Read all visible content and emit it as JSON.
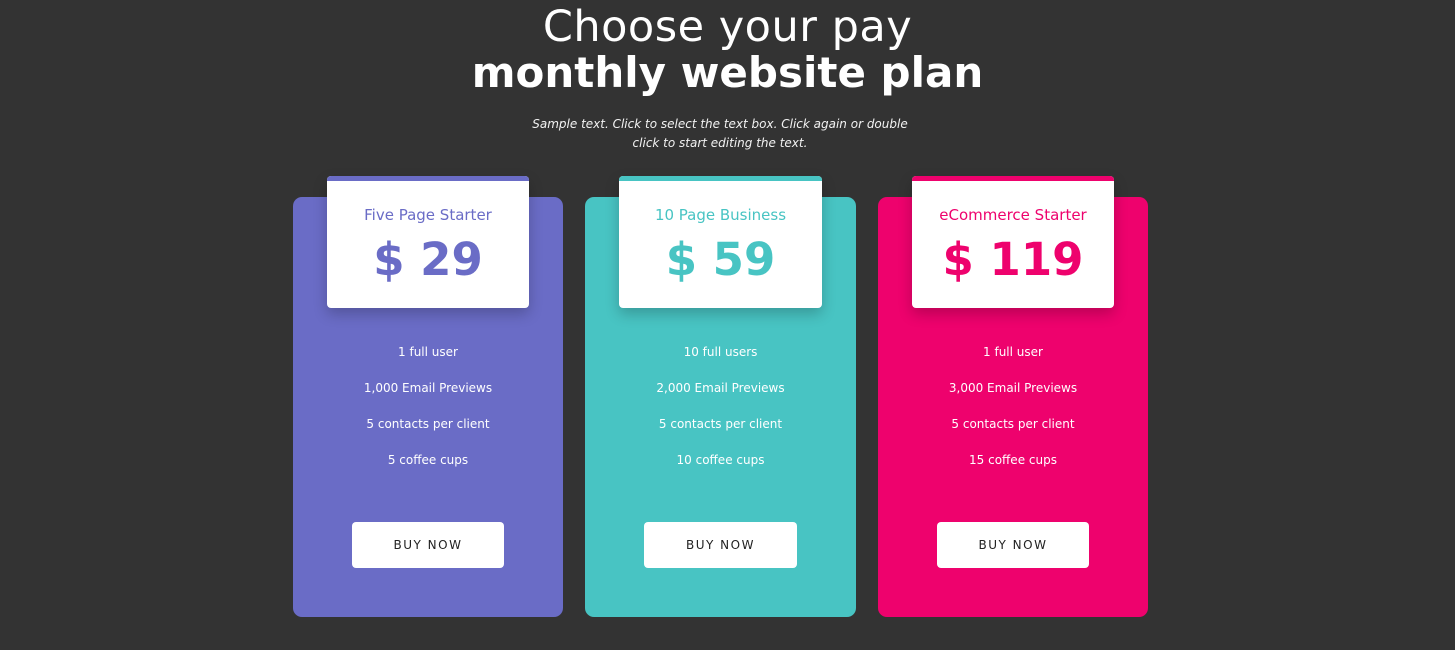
{
  "header": {
    "title_line1": "Choose your pay",
    "title_line2": "monthly website plan",
    "subtext": "Sample text. Click to select the text box. Click again or double click to start editing the text."
  },
  "colors": {
    "background": "#333333",
    "plan1": "#6a6cc6",
    "plan2": "#48c4c3",
    "plan3": "#ee026d"
  },
  "plans": [
    {
      "name": "Five Page Starter",
      "price": "$ 29",
      "features": [
        "1 full user",
        "1,000 Email Previews",
        "5 contacts per client",
        "5 coffee cups"
      ],
      "button": "BUY NOW"
    },
    {
      "name": "10 Page Business",
      "price": "$ 59",
      "features": [
        "10 full users",
        "2,000 Email Previews",
        "5 contacts per client",
        "10 coffee cups"
      ],
      "button": "BUY NOW"
    },
    {
      "name": "eCommerce Starter",
      "price": "$ 119",
      "features": [
        "1 full user",
        "3,000 Email Previews",
        "5 contacts per client",
        "15 coffee cups"
      ],
      "button": "BUY NOW"
    }
  ]
}
